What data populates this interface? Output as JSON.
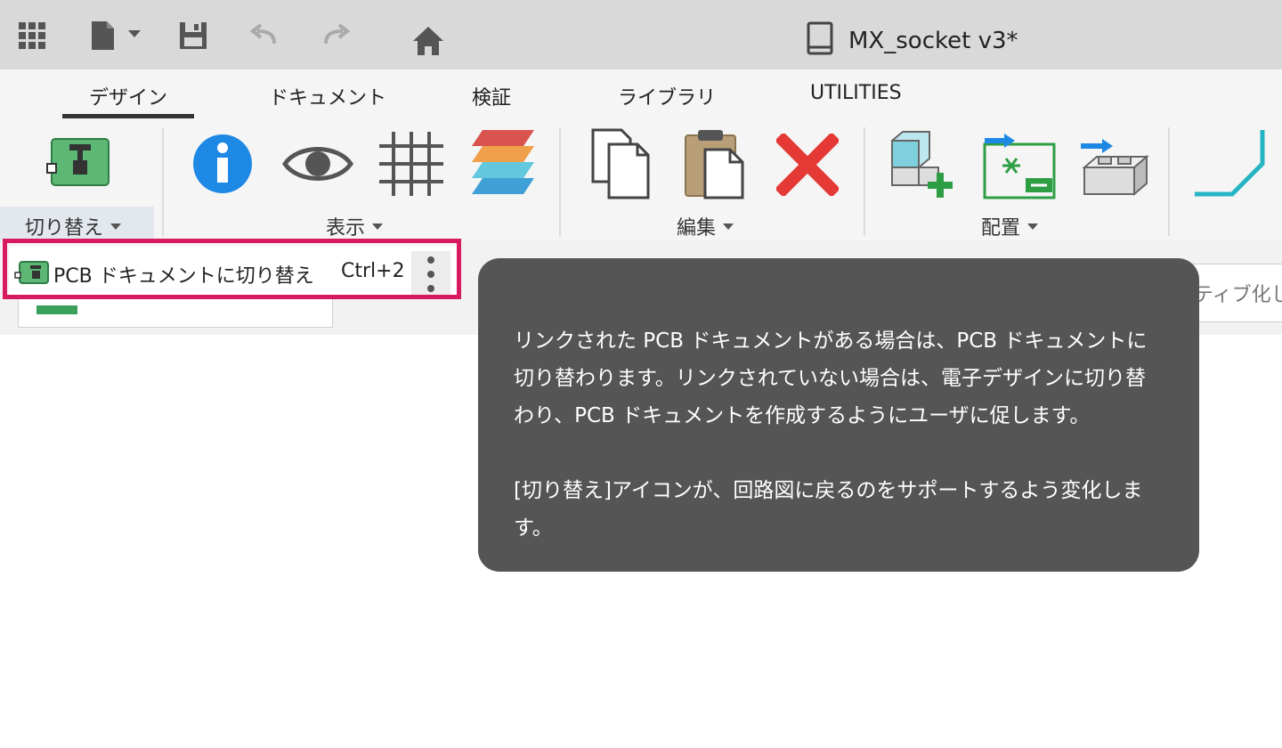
{
  "window": {
    "title": "MX_socket v3*"
  },
  "tabs": [
    {
      "label": "デザイン",
      "active": true
    },
    {
      "label": "ドキュメント",
      "active": false
    },
    {
      "label": "検証",
      "active": false
    },
    {
      "label": "ライブラリ",
      "active": false
    },
    {
      "label": "UTILITIES",
      "active": false
    }
  ],
  "ribbon": {
    "groups": [
      {
        "label": "切り替え",
        "tools": [
          "pcb-board-icon"
        ]
      },
      {
        "label": "表示",
        "tools": [
          "info-icon",
          "eye-icon",
          "grid-icon",
          "layers-icon"
        ]
      },
      {
        "label": "編集",
        "tools": [
          "copy-icon",
          "paste-icon",
          "delete-icon"
        ]
      },
      {
        "label": "配置",
        "tools": [
          "place-component-icon",
          "place-schematic-icon",
          "place-package-icon"
        ]
      }
    ]
  },
  "menu_item": {
    "label": "PCB ドキュメントに切り替え",
    "shortcut": "Ctrl+2"
  },
  "right_field_text": "ティブ化し",
  "tooltip": {
    "para1": "リンクされた PCB ドキュメントがある場合は、PCB ドキュメントに切り替わります。リンクされていない場合は、電子デザインに切り替わり、PCB ドキュメントを作成するようにユーザに促します。",
    "para2": "[切り替え]アイコンが、回路図に戻るのをサポートするよう変化します。"
  },
  "colors": {
    "highlight": "#d81b60",
    "tooltip_bg": "#555555",
    "accent_blue": "#1e88e5",
    "delete_red": "#e53935",
    "pcb_green": "#4caf50"
  }
}
